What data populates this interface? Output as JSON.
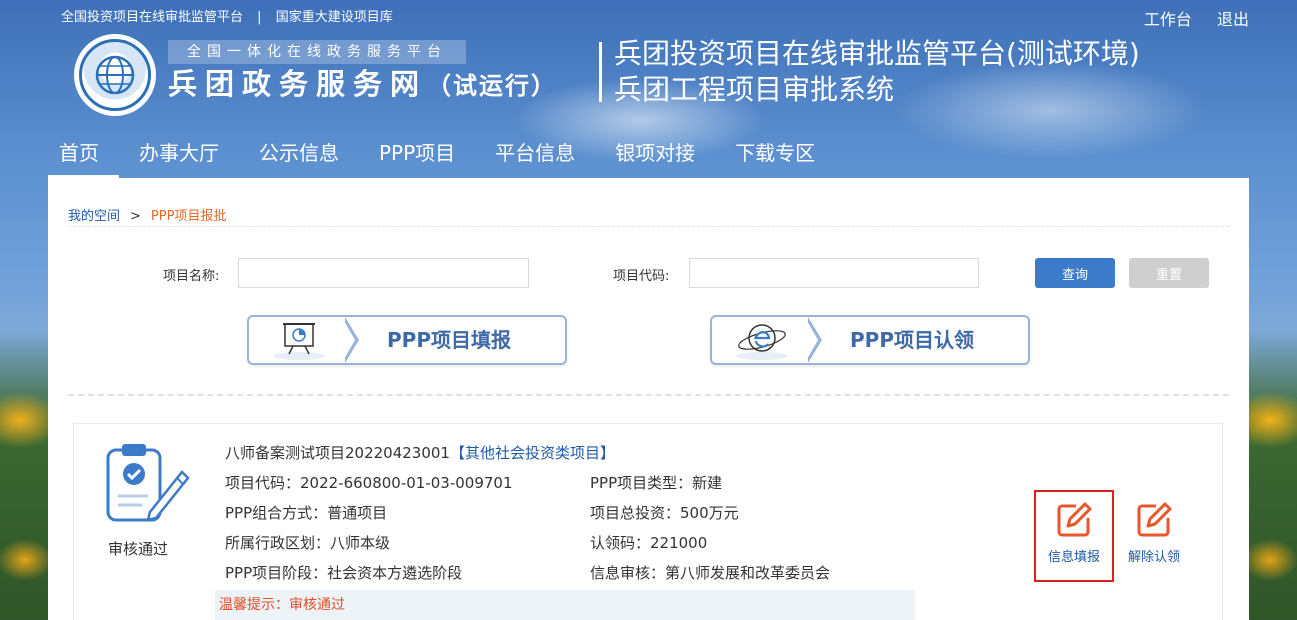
{
  "topbar": {
    "link1": "全国投资项目在线审批监管平台",
    "sep": "|",
    "link2": "国家重大建设项目库",
    "workbench": "工作台",
    "logout": "退出"
  },
  "logo": {
    "subtitle": "全国一体化在线政务服务平台",
    "main": "兵团政务服务网",
    "suffix": "（试运行）"
  },
  "site_title": {
    "line1": "兵团投资项目在线审批监管平台(测试环境)",
    "line2": "兵团工程项目审批系统"
  },
  "nav": [
    "首页",
    "办事大厅",
    "公示信息",
    "PPP项目",
    "平台信息",
    "银项对接",
    "下载专区"
  ],
  "breadcrumb": {
    "home": "我的空间",
    "arrow": ">",
    "current": "PPP项目报批"
  },
  "search": {
    "name_label": "项目名称:",
    "name_value": "",
    "code_label": "项目代码:",
    "code_value": "",
    "query_btn": "查询",
    "reset_btn": "重置"
  },
  "big_buttons": {
    "fill": "PPP项目填报",
    "claim": "PPP项目认领"
  },
  "project": {
    "status": "审核通过",
    "title": "八师备案测试项目20220423001",
    "type_tag": "【其他社会投资类项目】",
    "code": "项目代码：2022-660800-01-03-009701",
    "ppp_type": "PPP项目类型：新建",
    "combo": "PPP组合方式：普通项目",
    "total_invest": "项目总投资：500万元",
    "region": "所属行政区划：八师本级",
    "claim_code": "认领码：221000",
    "stage": "PPP项目阶段：社会资本方遴选阶段",
    "review": "信息审核：第八师发展和改革委员会",
    "tip": "温馨提示：审核通过",
    "action_fill": "信息填报",
    "action_unclaim": "解除认领"
  },
  "colors": {
    "link_blue": "#1f5aa8",
    "accent_orange": "#e06a2a",
    "tip_red": "#e0502a",
    "highlight_border": "#d9221c",
    "query_btn": "#3b7bc9"
  }
}
